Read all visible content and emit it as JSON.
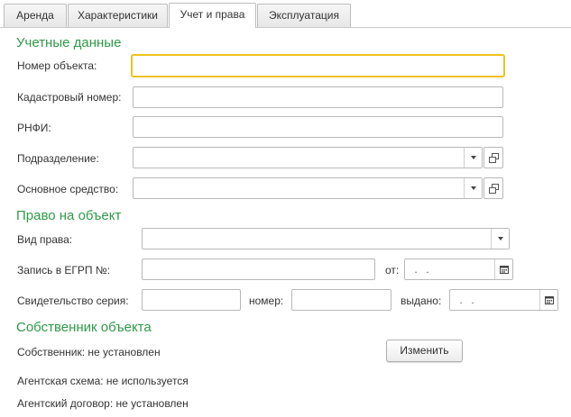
{
  "tabs": [
    {
      "label": "Аренда",
      "active": false
    },
    {
      "label": "Характеристики",
      "active": false
    },
    {
      "label": "Учет и права",
      "active": true
    },
    {
      "label": "Эксплуатация",
      "active": false
    }
  ],
  "accounting": {
    "title": "Учетные данные",
    "object_number_label": "Номер объекта:",
    "object_number_value": "",
    "cadastral_label": "Кадастровый номер:",
    "cadastral_value": "",
    "rnfi_label": "РНФИ:",
    "rnfi_value": "",
    "division_label": "Подразделение:",
    "division_value": "",
    "fixed_asset_label": "Основное средство:",
    "fixed_asset_value": ""
  },
  "rights": {
    "title": "Право на объект",
    "right_type_label": "Вид права:",
    "right_type_value": "",
    "egrp_label": "Запись в ЕГРП №:",
    "egrp_value": "",
    "from_label": "от:",
    "from_date": " .  .",
    "cert_series_label": "Свидетельство серия:",
    "cert_series_value": "",
    "number_label": "номер:",
    "number_value": "",
    "issued_label": "выдано:",
    "issued_date": " .  ."
  },
  "owner": {
    "title": "Собственник объекта",
    "owner_text": "Собственник: не установлен",
    "change_button": "Изменить",
    "agent_scheme_text": "Агентская схема: не используется",
    "agent_contract_text": "Агентский договор: не установлен"
  },
  "colors": {
    "section_title": "#2e9a47",
    "focus_border": "#f0c21c"
  }
}
